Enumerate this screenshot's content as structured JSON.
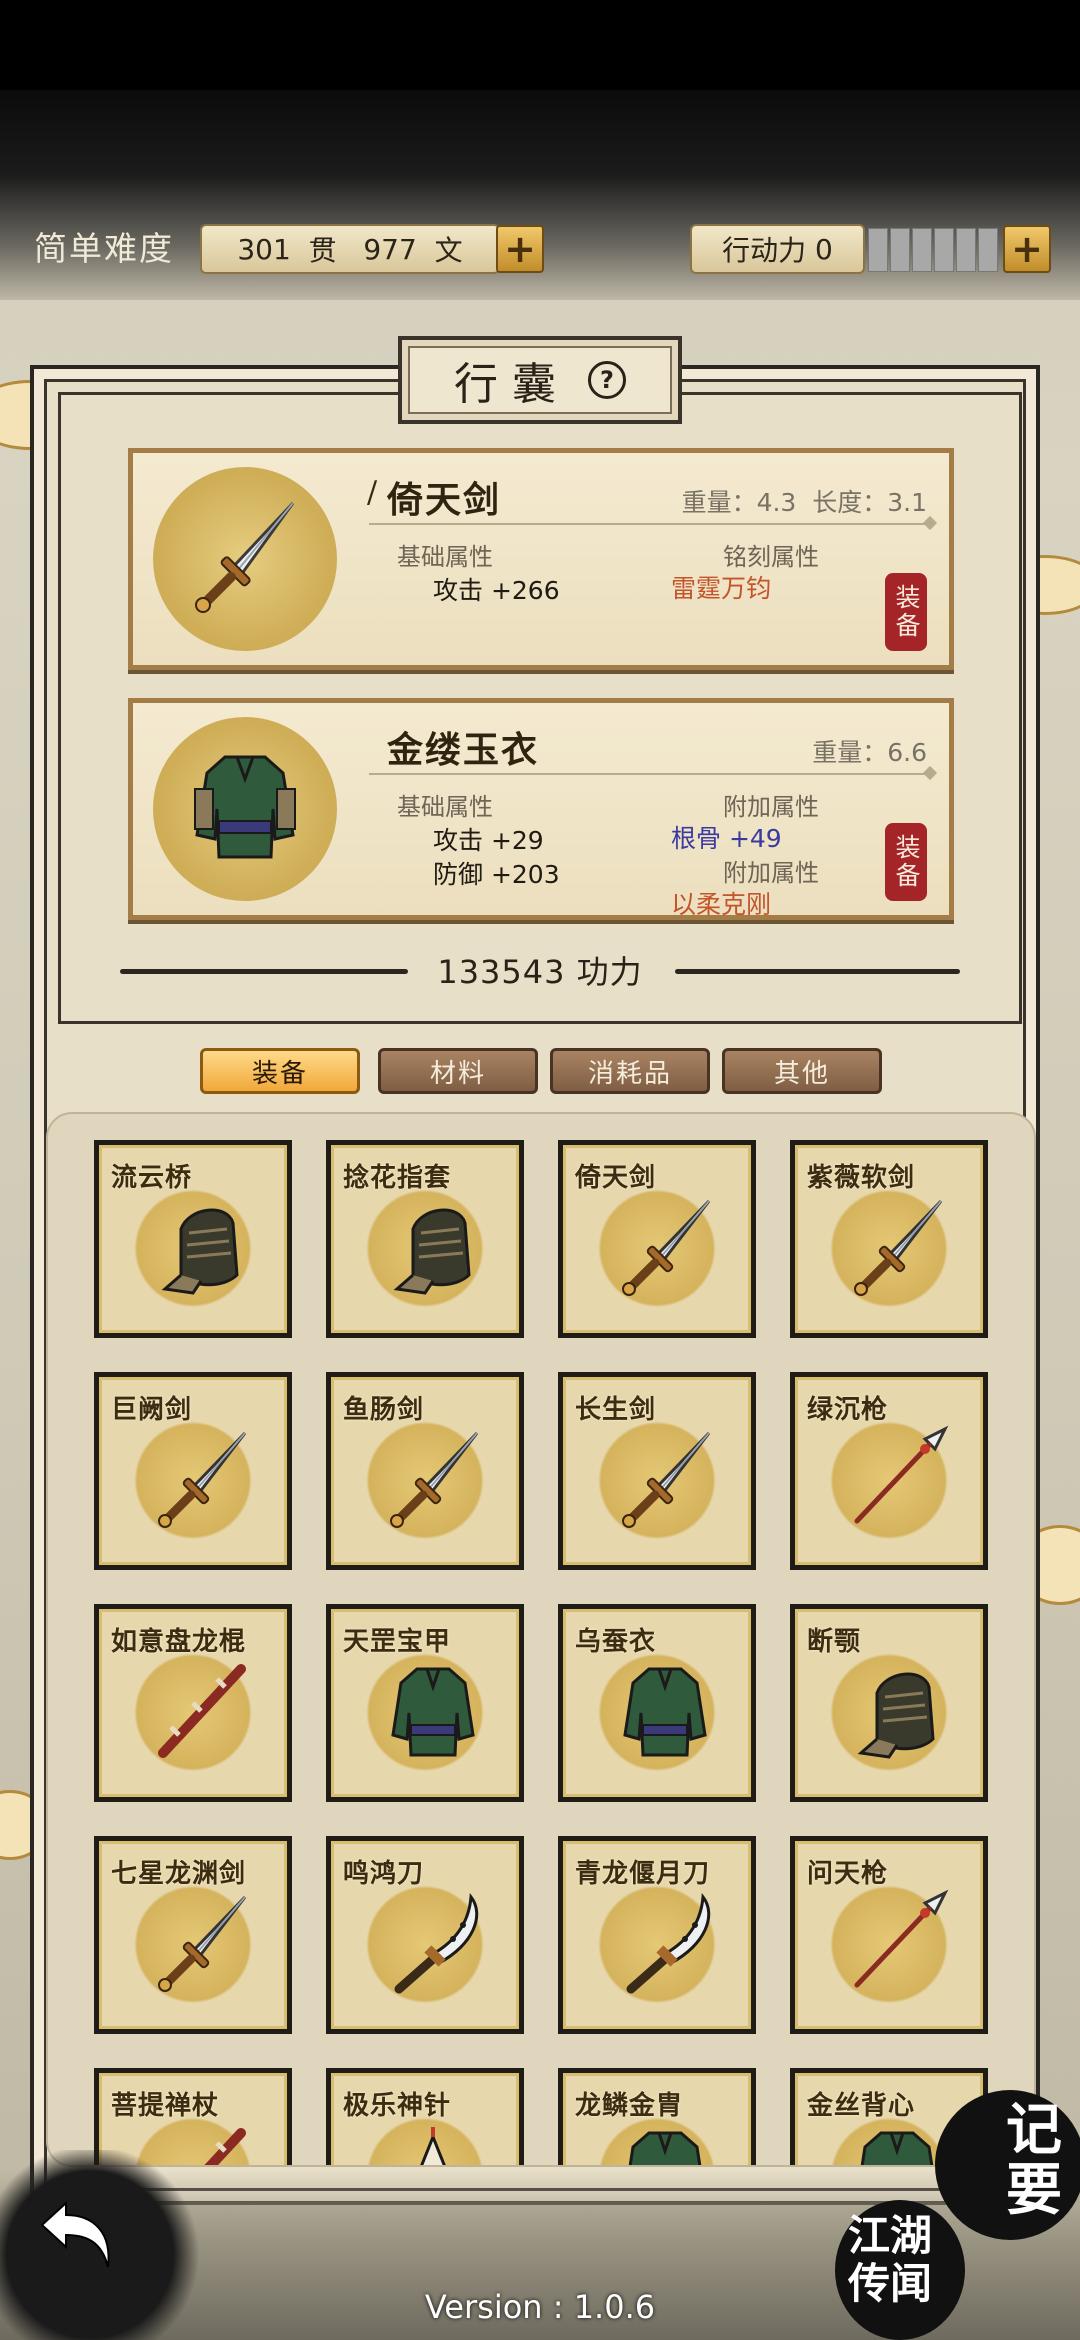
{
  "hud": {
    "difficulty": "简单难度",
    "money_guan": "301",
    "money_guan_unit": "贯",
    "money_wen": "977",
    "money_wen_unit": "文",
    "action_label": "行动力",
    "action_value": "0",
    "plus_symbol": "+",
    "energy_filled": 0,
    "energy_total": 6
  },
  "panel": {
    "title": "行囊",
    "help_symbol": "?"
  },
  "equipped": [
    {
      "name": "倚天剑",
      "weight": "重量：4.3",
      "length": "长度：3.1",
      "base_label": "基础属性",
      "base_stats": [
        "攻击 +266"
      ],
      "extra_label": "铭刻属性",
      "extra_value": "雷霆万钧",
      "extra_color": "#c4542a",
      "button": "装备"
    },
    {
      "name": "金缕玉衣",
      "weight": "重量：6.6",
      "base_label": "基础属性",
      "base_stats": [
        "攻击 +29",
        "防御 +203"
      ],
      "extra_label": "附加属性",
      "extra_value": "根骨 +49",
      "extra_color": "#3a3aa0",
      "extra_label2": "附加属性",
      "extra_value2": "以柔克刚",
      "extra_color2": "#c4542a",
      "button": "装备"
    }
  ],
  "power": {
    "value": "133543",
    "unit": "功力"
  },
  "tabs": [
    "装备",
    "材料",
    "消耗品",
    "其他"
  ],
  "active_tab": 0,
  "items": [
    {
      "name": "流云桥",
      "icon": "gauntlet-icon"
    },
    {
      "name": "捻花指套",
      "icon": "gauntlet-icon"
    },
    {
      "name": "倚天剑",
      "icon": "sword-icon"
    },
    {
      "name": "紫薇软剑",
      "icon": "sword-icon"
    },
    {
      "name": "巨阙剑",
      "icon": "sword-icon"
    },
    {
      "name": "鱼肠剑",
      "icon": "sword-icon"
    },
    {
      "name": "长生剑",
      "icon": "sword-icon"
    },
    {
      "name": "绿沉枪",
      "icon": "spear-icon"
    },
    {
      "name": "如意盘龙棍",
      "icon": "staff-icon"
    },
    {
      "name": "天罡宝甲",
      "icon": "armor-icon"
    },
    {
      "name": "乌蚕衣",
      "icon": "armor-icon"
    },
    {
      "name": "断颚",
      "icon": "gauntlet-icon"
    },
    {
      "name": "七星龙渊剑",
      "icon": "sword-icon"
    },
    {
      "name": "鸣鸿刀",
      "icon": "broadsword-icon"
    },
    {
      "name": "青龙偃月刀",
      "icon": "broadsword-icon"
    },
    {
      "name": "问天枪",
      "icon": "spear-icon"
    },
    {
      "name": "菩提禅杖",
      "icon": "staff-icon"
    },
    {
      "name": "极乐神针",
      "icon": "needle-icon"
    },
    {
      "name": "龙鳞金胄",
      "icon": "armor-icon"
    },
    {
      "name": "金丝背心",
      "icon": "armor-icon"
    }
  ],
  "footer": {
    "version": "Version : 1.0.6",
    "memo_label": "记要",
    "rumor_label": "江湖传闻"
  },
  "colors": {
    "accent_gold": "#d5b35d",
    "button_red": "#a52428",
    "tab_active": "#f0a93a",
    "tab_idle": "#7f5e43"
  }
}
